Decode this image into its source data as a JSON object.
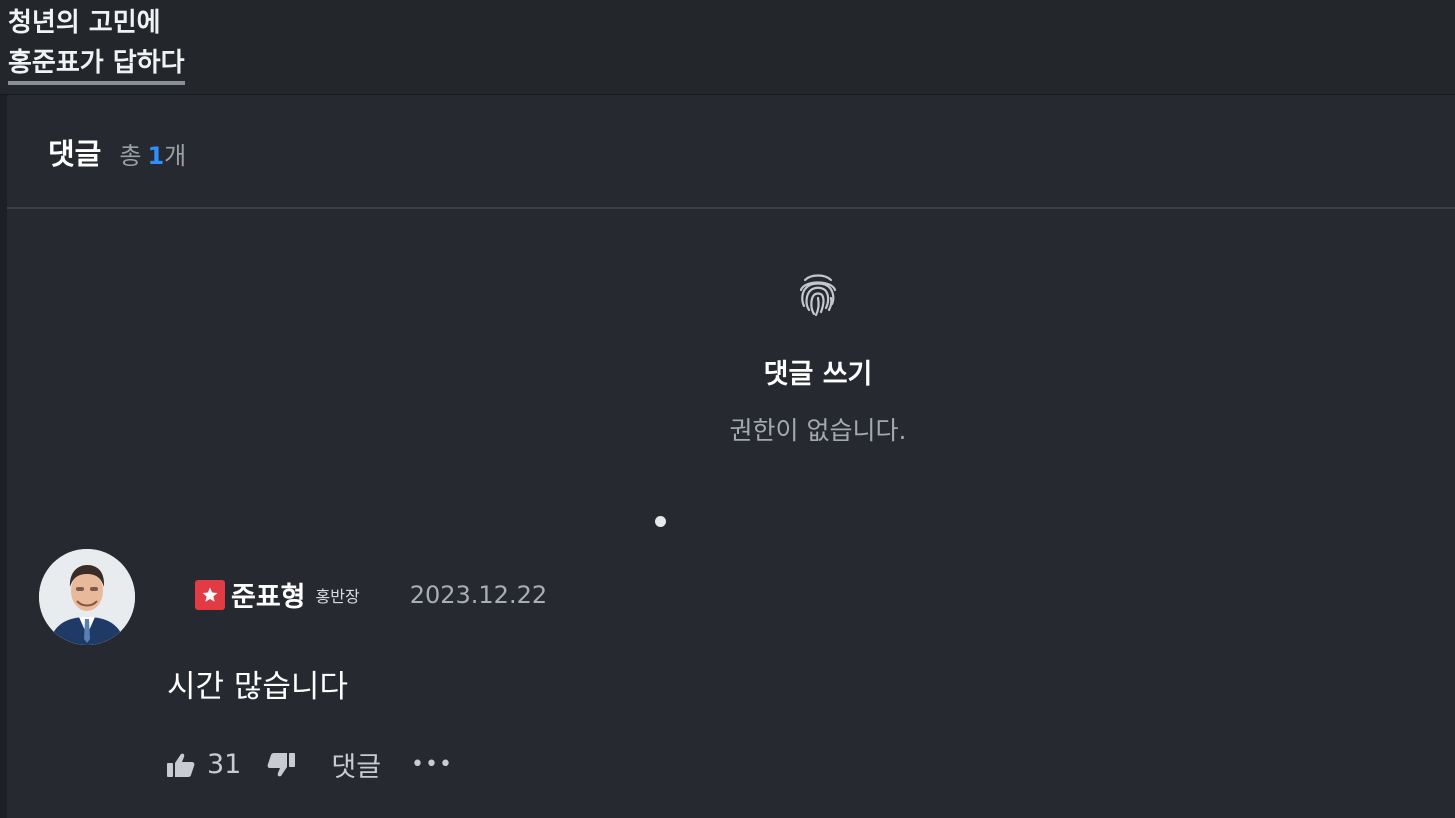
{
  "header": {
    "title_line1": "청년의 고민에",
    "title_line2": "홍준표가 답하다"
  },
  "comments": {
    "title": "댓글",
    "total_label": "총",
    "total_count": "1",
    "total_unit": "개"
  },
  "write": {
    "icon": "fingerprint-icon",
    "title": "댓글 쓰기",
    "subtitle": "권한이 없습니다."
  },
  "comment": {
    "author": "준표형",
    "role": "홍반장",
    "date": "2023.12.22",
    "text": "시간 많습니다",
    "likes": "31",
    "reply_label": "댓글",
    "more_label": "•••"
  },
  "colors": {
    "background": "#262a30",
    "accent": "#2f8fff",
    "badge": "#e23b43"
  }
}
